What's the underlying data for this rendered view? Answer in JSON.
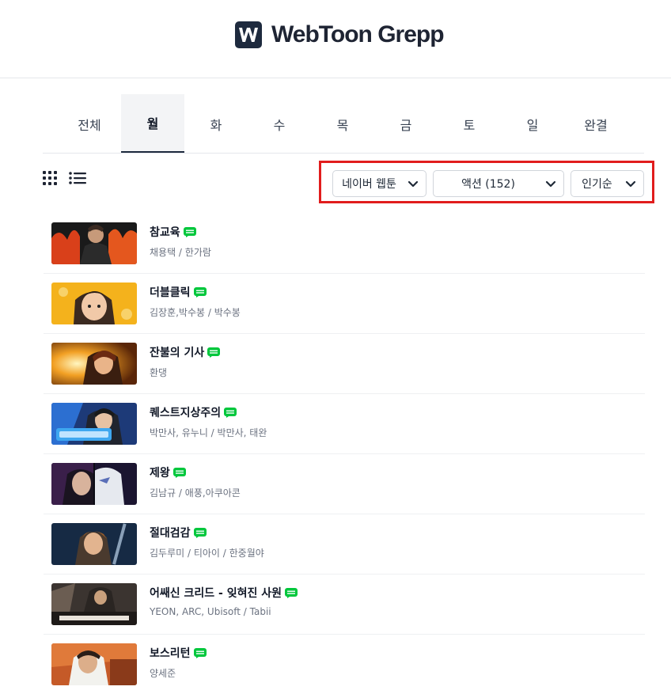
{
  "site": {
    "name": "WebToon Grepp"
  },
  "tabs": [
    {
      "label": "전체"
    },
    {
      "label": "월"
    },
    {
      "label": "화"
    },
    {
      "label": "수"
    },
    {
      "label": "목"
    },
    {
      "label": "금"
    },
    {
      "label": "토"
    },
    {
      "label": "일"
    },
    {
      "label": "완결"
    }
  ],
  "active_tab": "월",
  "view_modes": [
    "grid-icon",
    "list-icon"
  ],
  "filters": {
    "platform": "네이버 웹툰",
    "genre": "액션 (152)",
    "sort": "인기순",
    "highlight_color": "#e11d1d"
  },
  "webtoons": [
    {
      "title": "참교육",
      "authors": "채용택 / 한가람",
      "badge": "webtoon-badge-icon"
    },
    {
      "title": "더블클릭",
      "authors": "김장훈,박수봉 / 박수봉",
      "badge": "webtoon-badge-icon"
    },
    {
      "title": "잔불의 기사",
      "authors": "환댕",
      "badge": "webtoon-badge-icon"
    },
    {
      "title": "퀘스트지상주의",
      "authors": "박만사, 유누니 / 박만사, 태완",
      "badge": "webtoon-badge-icon"
    },
    {
      "title": "제왕",
      "authors": "김남규 / 애풍,아쿠아콘",
      "badge": "webtoon-badge-icon"
    },
    {
      "title": "절대검감",
      "authors": "김두루미 / 티아이 / 한중월야",
      "badge": "webtoon-badge-icon"
    },
    {
      "title": "어쌔신 크리드 - 잊혀진 사원",
      "authors": "YEON, ARC, Ubisoft / Tabii",
      "badge": "webtoon-badge-icon"
    },
    {
      "title": "보스리턴",
      "authors": "양세준",
      "badge": "webtoon-badge-icon"
    }
  ],
  "colors": {
    "brand_dark": "#1e2a3e",
    "badge_green": "#00c73c"
  }
}
